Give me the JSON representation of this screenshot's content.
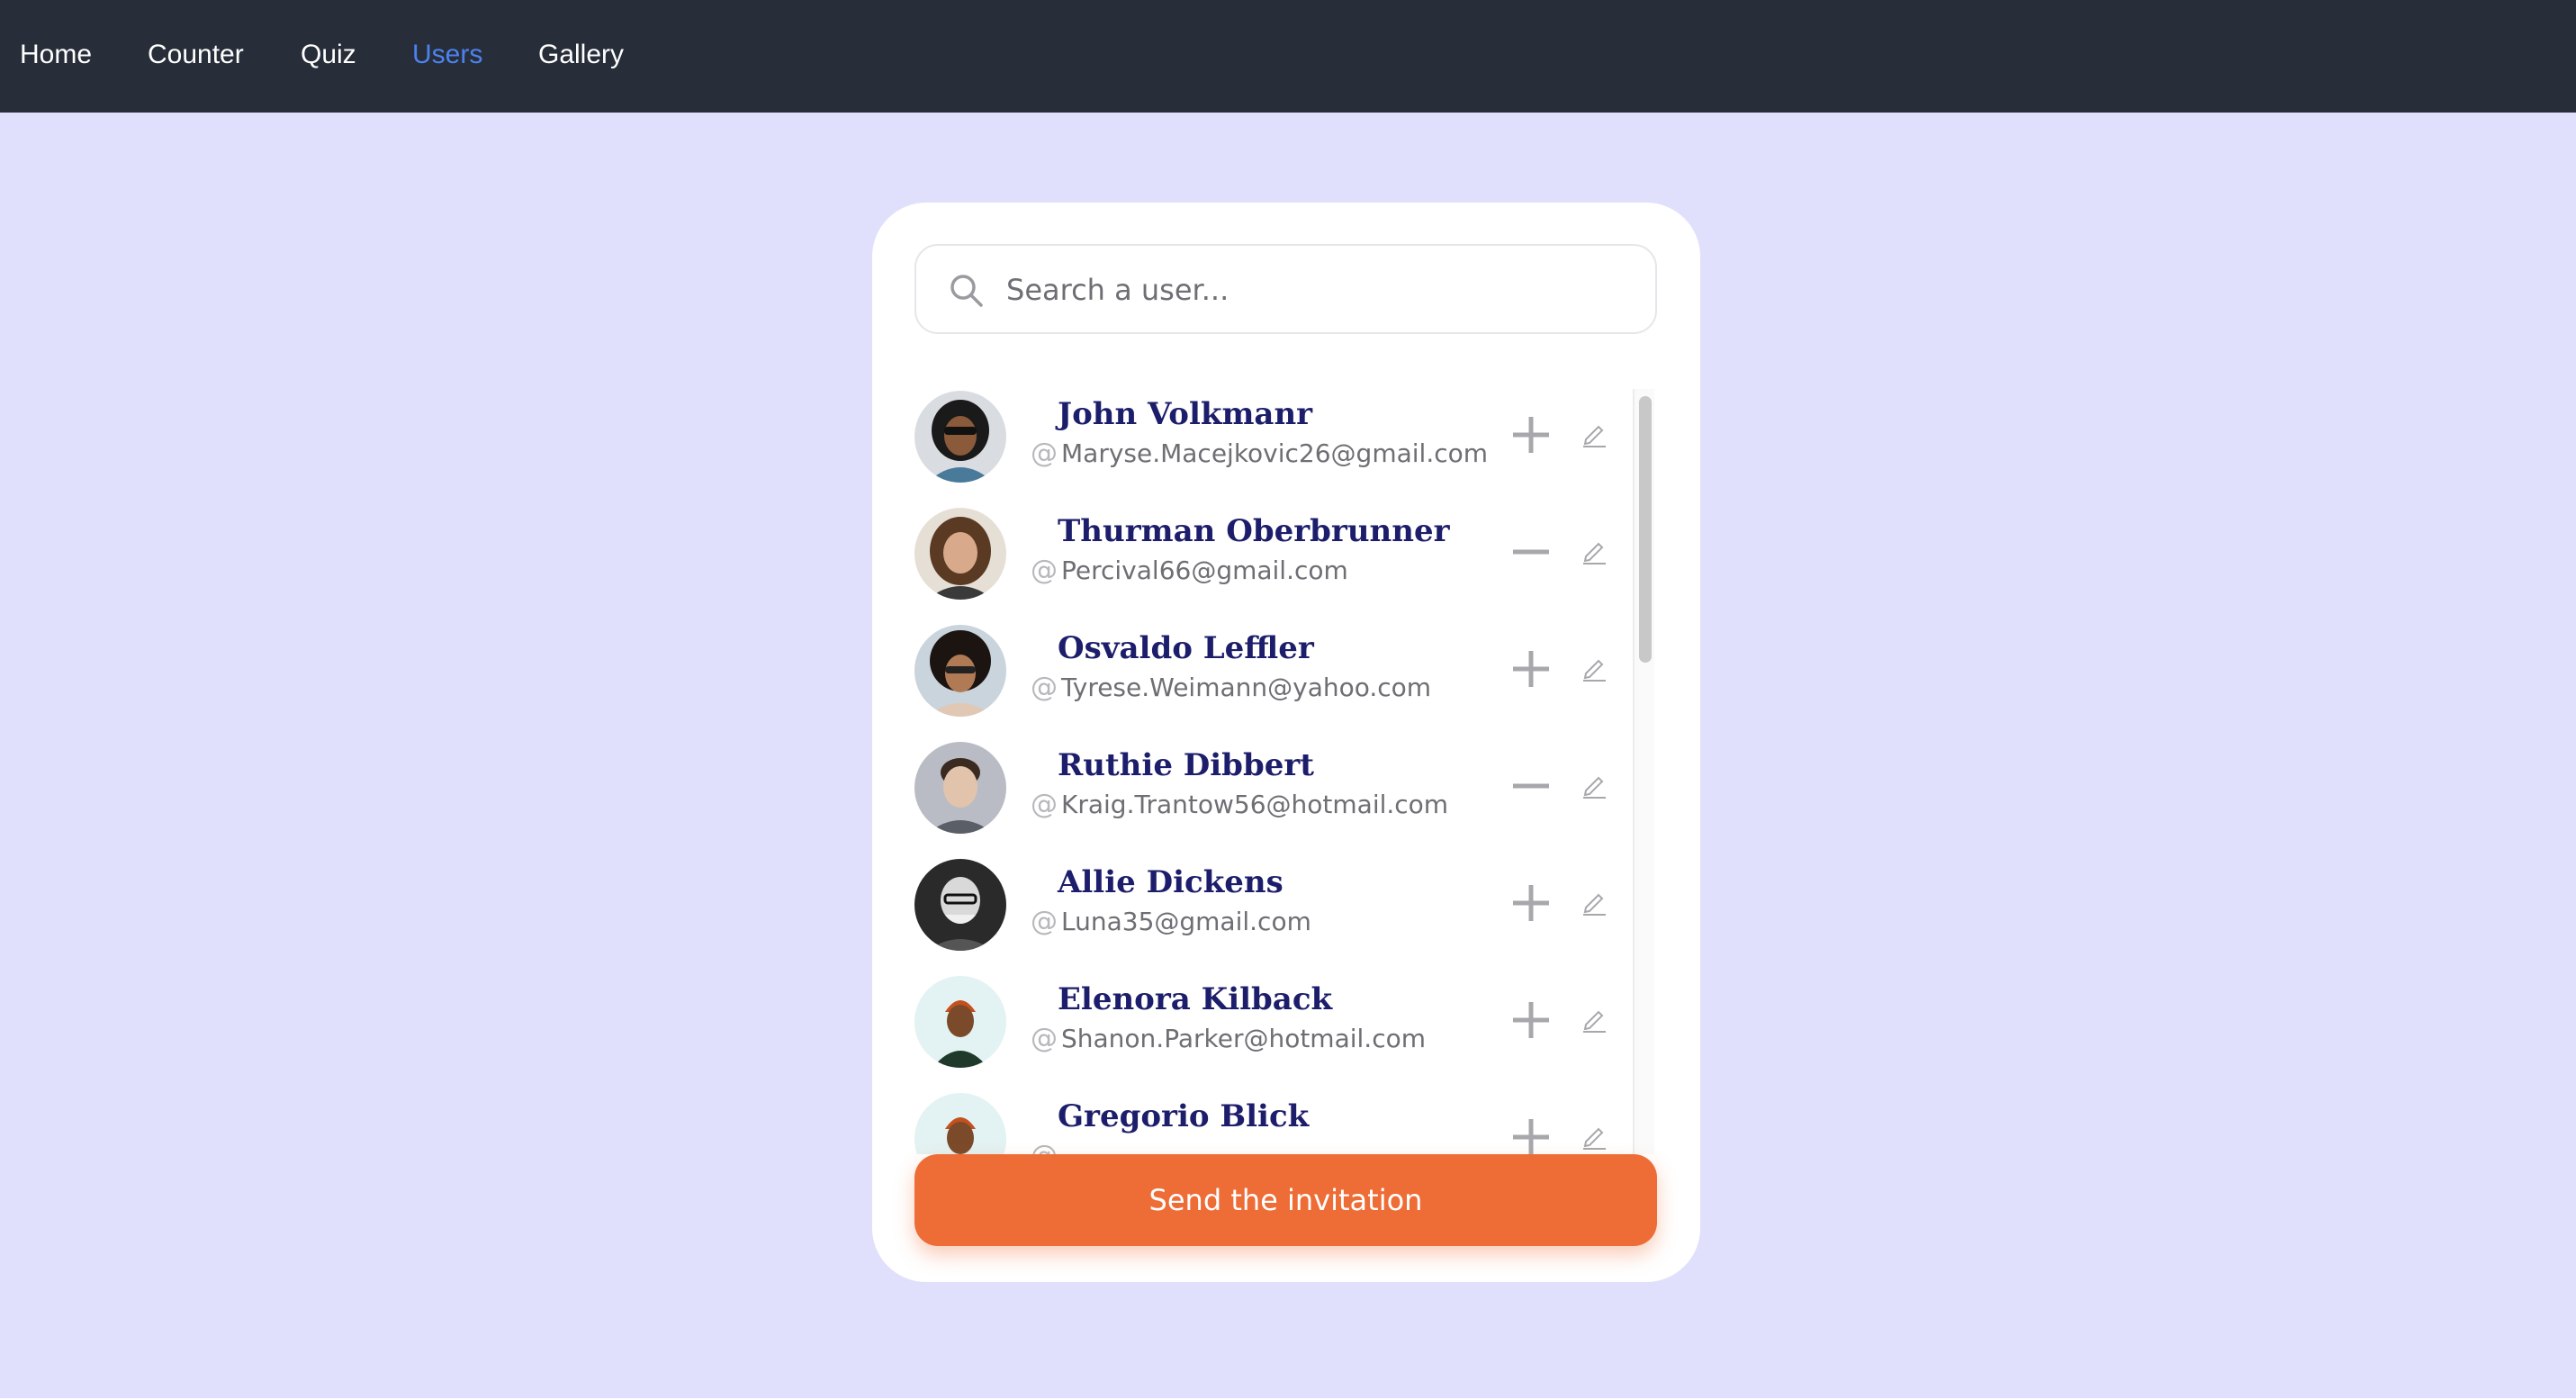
{
  "nav": {
    "items": [
      {
        "label": "Home"
      },
      {
        "label": "Counter"
      },
      {
        "label": "Quiz"
      },
      {
        "label": "Users"
      },
      {
        "label": "Gallery"
      }
    ],
    "active": "Users"
  },
  "search": {
    "placeholder": "Search a user..."
  },
  "users": [
    {
      "name": "John Volkmanr",
      "email": "Maryse.Macejkovic26@gmail.com",
      "action": "add"
    },
    {
      "name": "Thurman Oberbrunner",
      "email": "Percival66@gmail.com",
      "action": "remove"
    },
    {
      "name": "Osvaldo Leffler",
      "email": "Tyrese.Weimann@yahoo.com",
      "action": "add"
    },
    {
      "name": "Ruthie Dibbert",
      "email": "Kraig.Trantow56@hotmail.com",
      "action": "remove"
    },
    {
      "name": "Allie Dickens",
      "email": "Luna35@gmail.com",
      "action": "add"
    },
    {
      "name": "Elenora Kilback",
      "email": "Shanon.Parker@hotmail.com",
      "action": "add"
    },
    {
      "name": "Gregorio Blick",
      "email": "",
      "action": "add"
    }
  ],
  "cta": {
    "label": "Send the invitation"
  },
  "colors": {
    "nav_bg": "#272e39",
    "nav_active": "#4c82f0",
    "page_bg": "#e0e0fc",
    "name": "#1d1e6b",
    "cta": "#ee6c36"
  }
}
